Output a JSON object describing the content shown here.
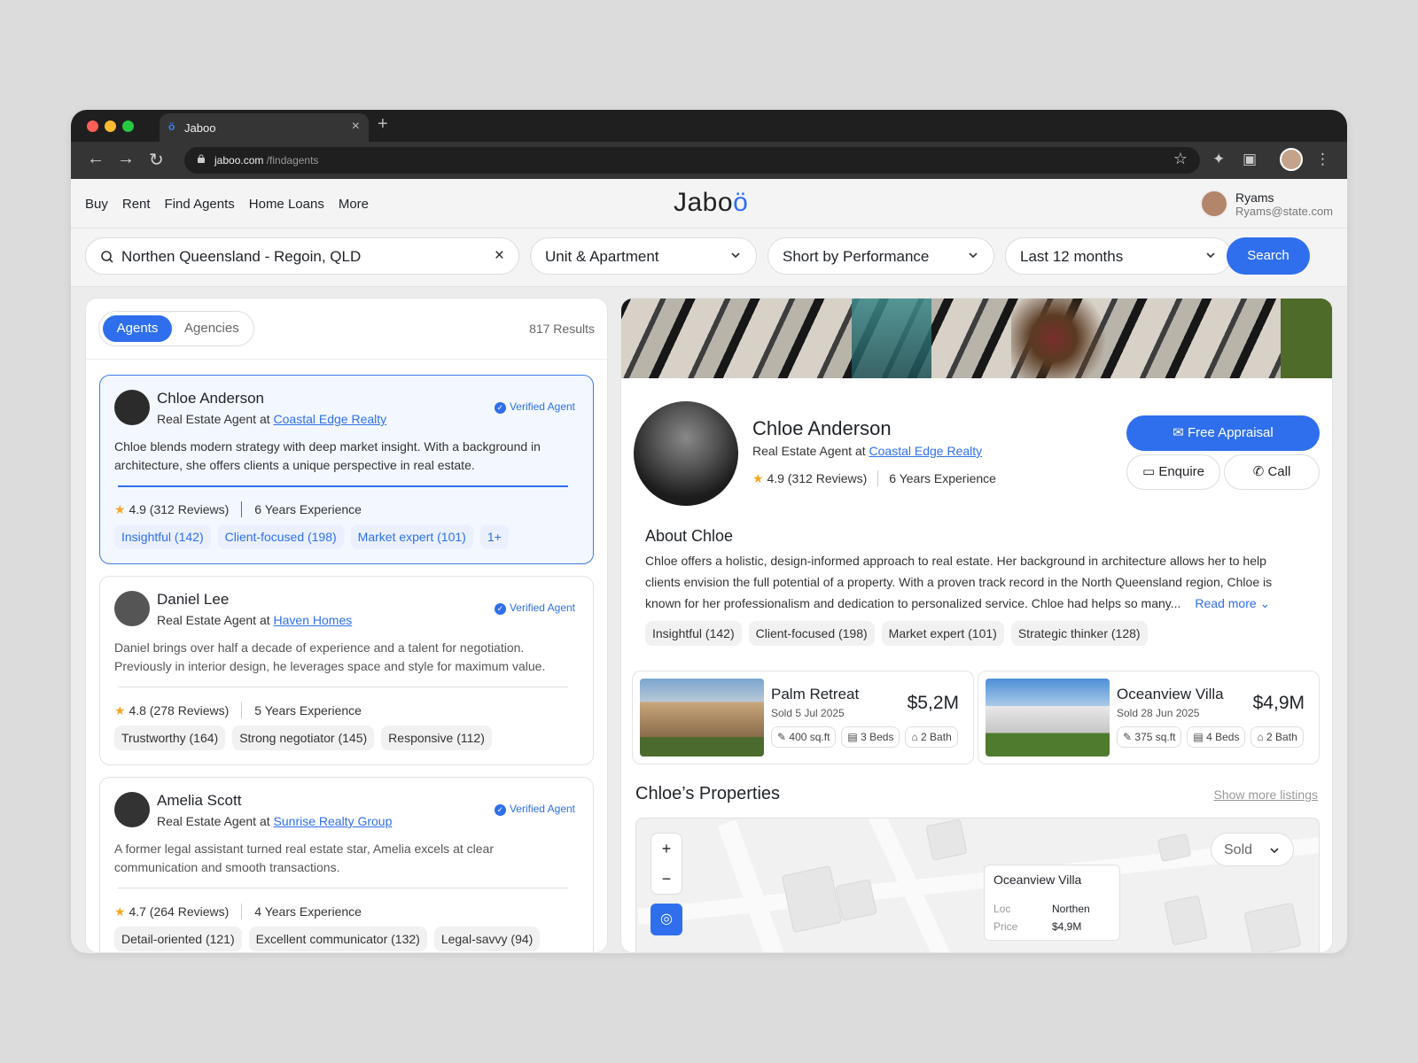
{
  "browser": {
    "tab_title": "Jaboo",
    "tab_favicon": "ö",
    "url_domain": "jaboo.com",
    "url_path": " /findagents",
    "dots": [
      "#ff5f57",
      "#febc2e",
      "#28c840"
    ]
  },
  "nav": {
    "items": [
      "Buy",
      "Rent",
      "Find Agents",
      "Home Loans",
      "More"
    ],
    "logo_main": "Jabo",
    "logo_accent": "ö",
    "user_name": "Ryams",
    "user_email": "Ryams@state.com"
  },
  "filters": {
    "location": "Northen Queensland - Regoin, QLD",
    "property_type": "Unit & Apartment",
    "sort": "Short by Performance",
    "period": "Last 12 months",
    "search_label": "Search"
  },
  "list": {
    "tab_active": "Agents",
    "tab_inactive": "Agencies",
    "results": "817 Results",
    "verified_label": "Verified Agent",
    "agents": [
      {
        "name": "Chloe Anderson",
        "role_prefix": "Real Estate Agent at ",
        "agency": "Coastal Edge Realty",
        "desc": "Chloe blends modern strategy with deep market insight. With a background in architecture, she offers clients a unique perspective in real estate.",
        "rating": "4.9 (312 Reviews)",
        "experience": "6 Years Experience",
        "tags": [
          "Insightful (142)",
          "Client-focused (198)",
          "Market expert (101)",
          "1+"
        ]
      },
      {
        "name": "Daniel Lee",
        "role_prefix": "Real Estate Agent at ",
        "agency": "Haven Homes",
        "desc": "Daniel brings over half a decade of experience and a talent for negotiation. Previously in interior design, he leverages space and style for maximum value.",
        "rating": "4.8 (278 Reviews)",
        "experience": "5 Years Experience",
        "tags": [
          "Trustworthy (164)",
          "Strong negotiator (145)",
          "Responsive (112)"
        ]
      },
      {
        "name": "Amelia Scott",
        "role_prefix": "Real Estate Agent at ",
        "agency": "Sunrise Realty Group",
        "desc": "A former legal assistant turned real estate star, Amelia excels at clear communication and smooth transactions.",
        "rating": "4.7 (264 Reviews)",
        "experience": "4 Years Experience",
        "tags": [
          "Detail-oriented (121)",
          "Excellent communicator (132)",
          "Legal-savvy (94)"
        ]
      }
    ]
  },
  "profile": {
    "name": "Chloe Anderson",
    "role_prefix": "Real Estate Agent at ",
    "agency": "Coastal Edge Realty",
    "rating": "4.9 (312 Reviews)",
    "experience": "6 Years Experience",
    "appraisal": "Free Appraisal",
    "enquire": "Enquire",
    "call": "Call",
    "about_title": "About Chloe",
    "about_text": "Chloe offers a holistic, design-informed approach to real estate. Her background in architecture allows her to help clients envision the full potential of a property. With a proven track record in the North Queensland region, Chloe is known for her professionalism and dedication to personalized service. Chloe had helps so many...",
    "read_more": "Read more ⌄",
    "tags": [
      "Insightful (142)",
      "Client-focused (198)",
      "Market expert (101)",
      "Strategic thinker (128)"
    ]
  },
  "properties": [
    {
      "name": "Palm Retreat",
      "sold": "Sold 5 Jul 2025",
      "price": "$5,2M",
      "area": "400 sq.ft",
      "beds": "3 Beds",
      "bath": "2 Bath"
    },
    {
      "name": "Oceanview Villa",
      "sold": "Sold 28 Jun 2025",
      "price": "$4,9M",
      "area": "375 sq.ft",
      "beds": "4 Beds",
      "bath": "2 Bath"
    }
  ],
  "props_section": {
    "title": "Chloe’s Properties",
    "show_more": "Show more listings"
  },
  "map": {
    "filter": "Sold",
    "popup_title": "Oceanview Villa",
    "loc_label": "Loc",
    "loc_value": "Northen",
    "price_label": "Price",
    "price_value": "$4,9M"
  }
}
